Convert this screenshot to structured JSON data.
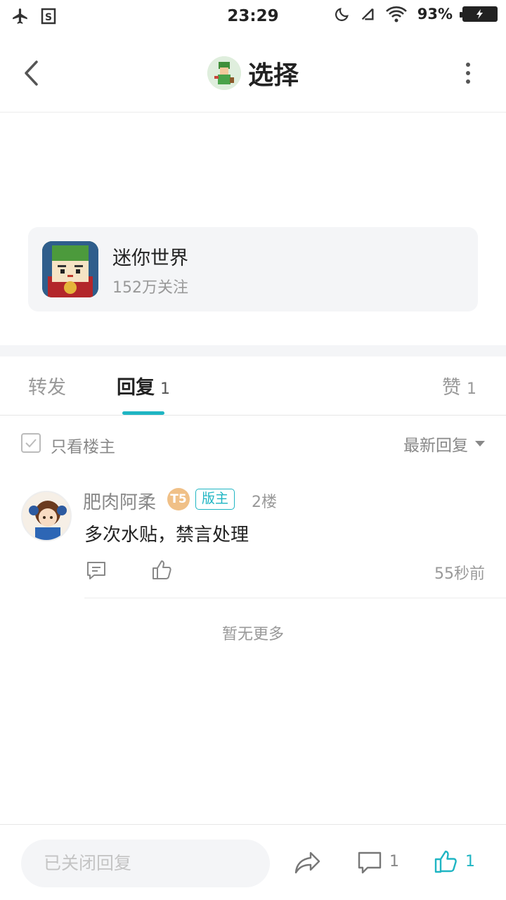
{
  "status_bar": {
    "time": "23:29",
    "battery": "93%",
    "icons": [
      "airplane-mode-icon",
      "s-app-icon",
      "moon-icon",
      "mute-icon",
      "wifi-icon",
      "battery-icon"
    ]
  },
  "header": {
    "title": "选择",
    "back_icon": "chevron-left-icon",
    "more_icon": "more-vertical-icon"
  },
  "forum": {
    "name": "迷你世界",
    "followers": "152万关注"
  },
  "tabs": {
    "forward": {
      "label": "转发"
    },
    "reply": {
      "label": "回复",
      "count": "1"
    },
    "like": {
      "label": "赞",
      "count": "1"
    }
  },
  "filter": {
    "only_op_label": "只看楼主",
    "sort_label": "最新回复"
  },
  "reply": {
    "username": "肥肉阿柔",
    "level_badge": "T5",
    "role_badge": "版主",
    "floor": "2楼",
    "content": "多次水贴，禁言处理",
    "time": "55秒前"
  },
  "no_more_text": "暂无更多",
  "bottom_bar": {
    "input_placeholder": "已关闭回复",
    "comment_count": "1",
    "like_count": "1"
  },
  "colors": {
    "accent": "#1fb5c3",
    "muted_text": "#999999",
    "card_bg": "#f4f5f7"
  }
}
